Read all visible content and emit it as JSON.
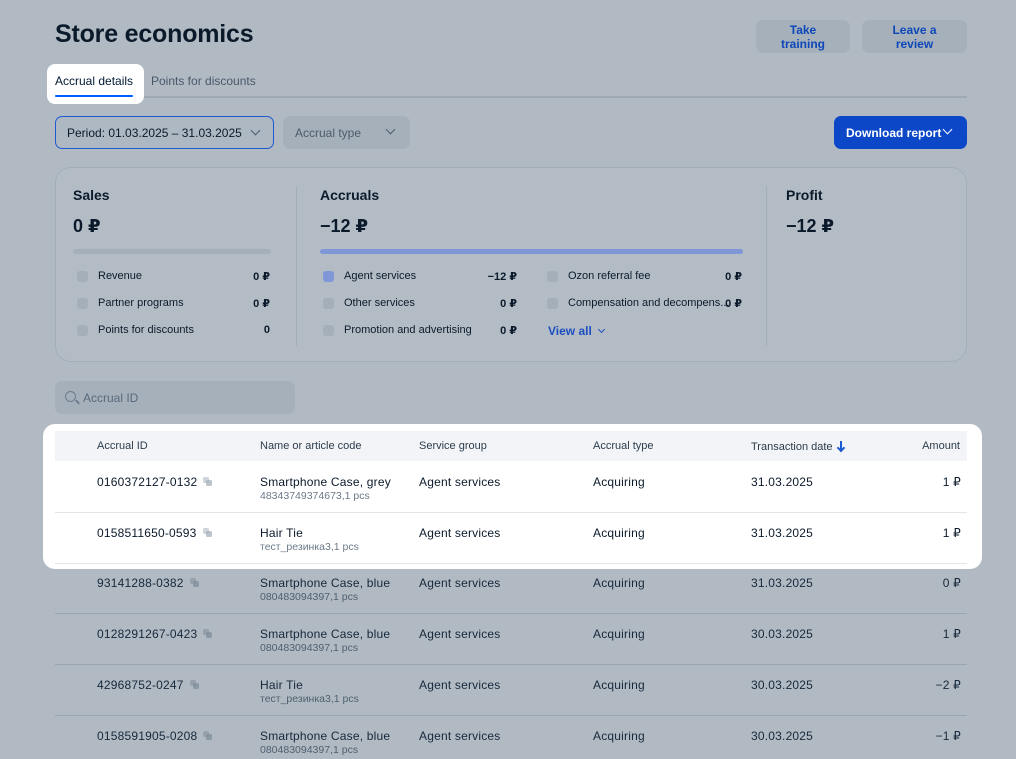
{
  "header": {
    "title": "Store economics",
    "take_training": "Take training",
    "leave_review": "Leave a review"
  },
  "tabs": [
    {
      "label": "Accrual details",
      "active": true
    },
    {
      "label": "Points for discounts",
      "active": false
    }
  ],
  "filters": {
    "period": "Period: 01.03.2025 – 31.03.2025",
    "accrual_type": "Accrual type",
    "download": "Download report"
  },
  "summary": {
    "sales": {
      "title": "Sales",
      "value": "0 ₽",
      "items": [
        {
          "label": "Revenue",
          "value": "0 ₽"
        },
        {
          "label": "Partner programs",
          "value": "0 ₽"
        },
        {
          "label": "Points for discounts",
          "value": "0"
        }
      ]
    },
    "accruals": {
      "title": "Accruals",
      "value": "−12 ₽",
      "items": [
        {
          "label": "Agent services",
          "value": "−12 ₽"
        },
        {
          "label": "Other services",
          "value": "0 ₽"
        },
        {
          "label": "Promotion and advertising",
          "value": "0 ₽"
        },
        {
          "label": "Ozon referral fee",
          "value": "0 ₽"
        },
        {
          "label": "Compensation and decompens...",
          "value": "0 ₽"
        }
      ],
      "view_all": "View all"
    },
    "profit": {
      "title": "Profit",
      "value": "−12 ₽"
    }
  },
  "search": {
    "placeholder": "Accrual ID"
  },
  "table": {
    "columns": [
      "Accrual ID",
      "Name or article code",
      "Service group",
      "Accrual type",
      "Transaction date",
      "Amount"
    ],
    "rows": [
      {
        "id": "0160372127-0132",
        "name": "Smartphone Case, grey",
        "sub": "48343749374673,1 pcs",
        "group": "Agent services",
        "type": "Acquiring",
        "date": "31.03.2025",
        "amount": "1 ₽"
      },
      {
        "id": "0158511650-0593",
        "name": "Hair Tie",
        "sub": "тест_резинка3,1 pcs",
        "group": "Agent services",
        "type": "Acquiring",
        "date": "31.03.2025",
        "amount": "1 ₽"
      },
      {
        "id": "93141288-0382",
        "name": "Smartphone Case, blue",
        "sub": "080483094397,1 pcs",
        "group": "Agent services",
        "type": "Acquiring",
        "date": "31.03.2025",
        "amount": "0 ₽"
      },
      {
        "id": "0128291267-0423",
        "name": "Smartphone Case, blue",
        "sub": "080483094397,1 pcs",
        "group": "Agent services",
        "type": "Acquiring",
        "date": "30.03.2025",
        "amount": "1 ₽"
      },
      {
        "id": "42968752-0247",
        "name": "Hair Tie",
        "sub": "тест_резинка3,1 pcs",
        "group": "Agent services",
        "type": "Acquiring",
        "date": "30.03.2025",
        "amount": "−2 ₽"
      },
      {
        "id": "0158591905-0208",
        "name": "Smartphone Case, blue",
        "sub": "080483094397,1 pcs",
        "group": "Agent services",
        "type": "Acquiring",
        "date": "30.03.2025",
        "amount": "−1 ₽"
      }
    ]
  }
}
